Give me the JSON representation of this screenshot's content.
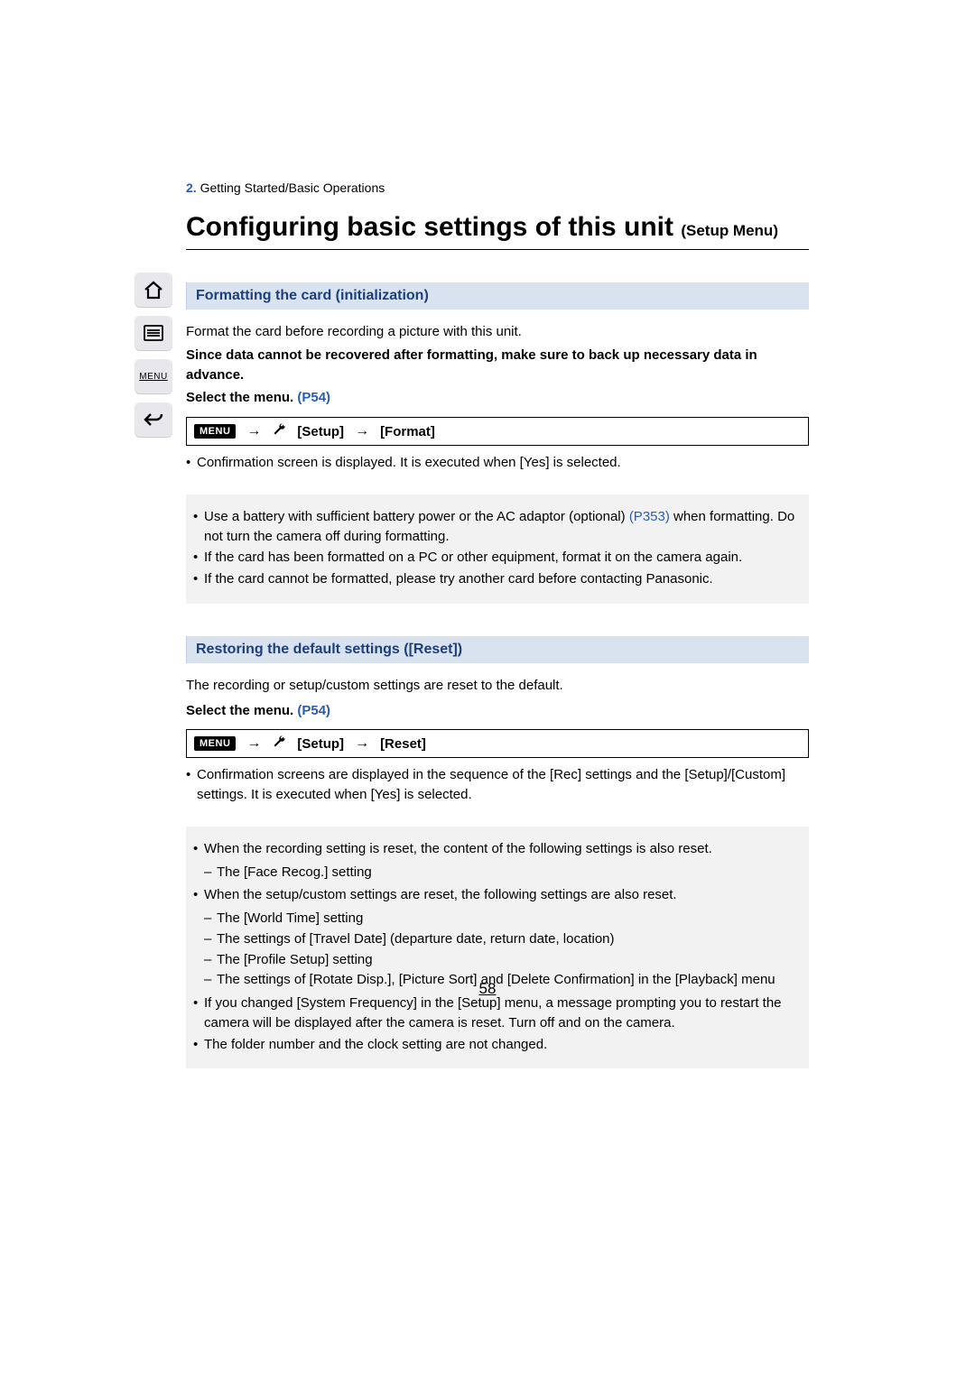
{
  "breadcrumb": {
    "num": "2.",
    "text": "Getting Started/Basic Operations"
  },
  "title": {
    "main": "Configuring basic settings of this unit ",
    "sub": "(Setup Menu)"
  },
  "sidebar": {
    "menu_label": "MENU"
  },
  "menu_chip": "MENU",
  "arrow": "→",
  "section1": {
    "heading": "Formatting the card (initialization)",
    "intro": "Format the card before recording a picture with this unit.",
    "warning": "Since data cannot be recovered after formatting, make sure to back up necessary data in advance.",
    "select_menu": "Select the menu. ",
    "select_menu_link": "(P54)",
    "path": {
      "setup": "[Setup]",
      "target": "[Format]"
    },
    "confirm": "Confirmation screen is displayed. It is executed when [Yes] is selected.",
    "info1a": "Use a battery with sufficient battery power or the AC adaptor (optional) ",
    "info1_link": "(P353)",
    "info1b": " when formatting. Do not turn the camera off during formatting.",
    "info2": "If the card has been formatted on a PC or other equipment, format it on the camera again.",
    "info3": "If the card cannot be formatted, please try another card before contacting Panasonic."
  },
  "section2": {
    "heading": "Restoring the default settings ([Reset])",
    "intro": "The recording or setup/custom settings are reset to the default.",
    "select_menu": "Select the menu. ",
    "select_menu_link": "(P54)",
    "path": {
      "setup": "[Setup]",
      "target": "[Reset]"
    },
    "confirm": "Confirmation screens are displayed in the sequence of the [Rec] settings and the [Setup]/[Custom] settings. It is executed when [Yes] is selected.",
    "info": {
      "b1": "When the recording setting is reset, the content of the following settings is also reset.",
      "b1d1": "The [Face Recog.] setting",
      "b2": "When the setup/custom settings are reset, the following settings are also reset.",
      "b2d1": "The [World Time] setting",
      "b2d2": "The settings of [Travel Date] (departure date, return date, location)",
      "b2d3": "The [Profile Setup] setting",
      "b2d4": "The settings of [Rotate Disp.], [Picture Sort] and [Delete Confirmation] in the [Playback] menu",
      "b3": "If you changed [System Frequency] in the [Setup] menu, a message prompting you to restart the camera will be displayed after the camera is reset. Turn off and on the camera.",
      "b4": "The folder number and the clock setting are not changed."
    }
  },
  "page_number": "58"
}
